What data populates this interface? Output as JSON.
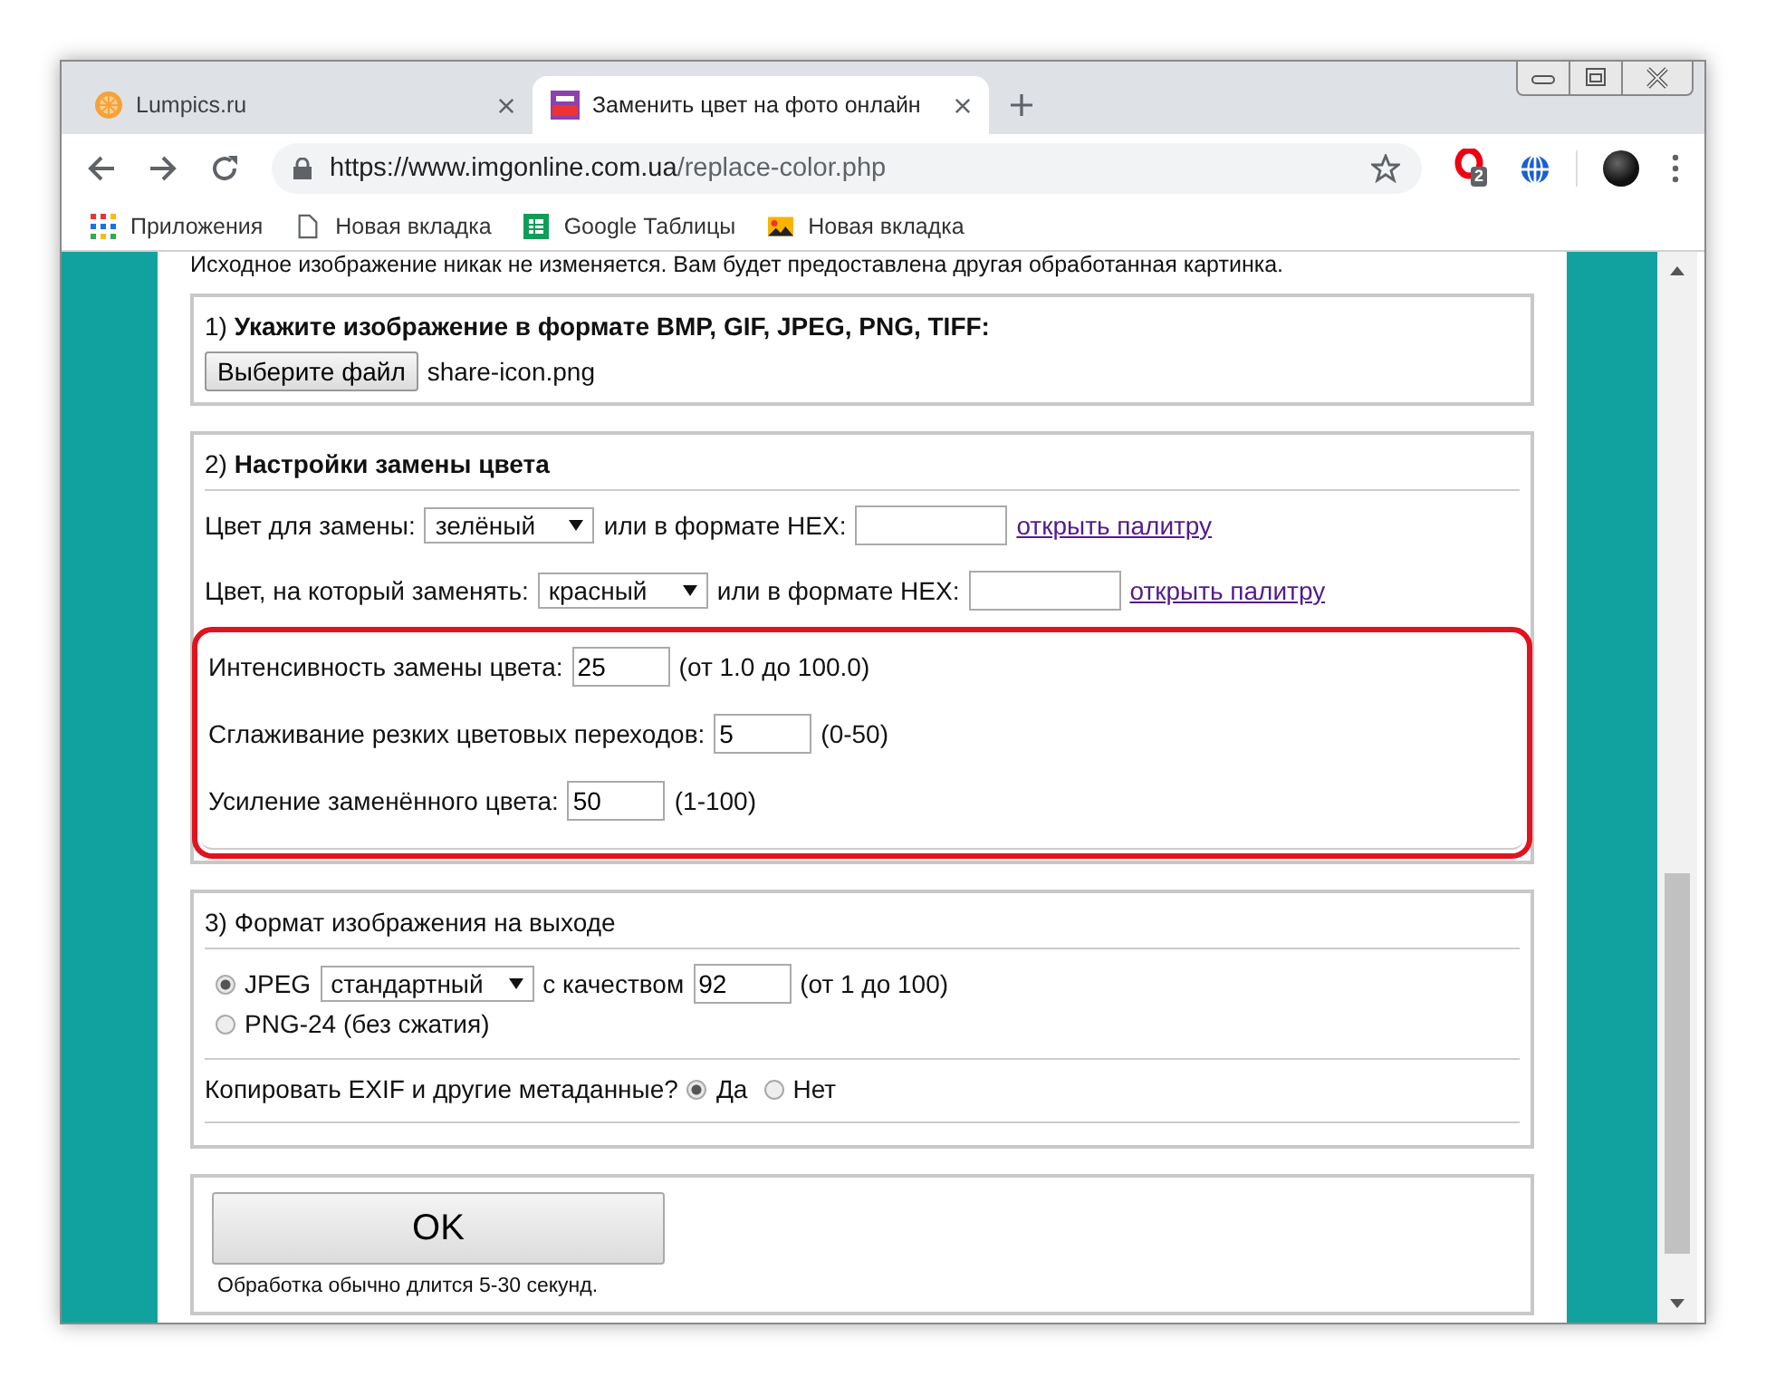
{
  "tabs": [
    {
      "title": "Lumpics.ru",
      "kind": "orange",
      "selected": false
    },
    {
      "title": "Заменить цвет на фото онлайн",
      "kind": "jpg",
      "selected": true
    }
  ],
  "address": {
    "host": "https://www.imgonline.com.ua",
    "path": "/replace-color.php"
  },
  "extension_badge": "2",
  "bookmarks": [
    {
      "label": "Приложения",
      "kind": "apps"
    },
    {
      "label": "Новая вкладка",
      "kind": "page"
    },
    {
      "label": "Google Таблицы",
      "kind": "sheets"
    },
    {
      "label": "Новая вкладка",
      "kind": "image"
    }
  ],
  "intro": "Исходное изображение никак не изменяется. Вам будет предоставлена другая обработанная картинка.",
  "section1": {
    "number": "1)",
    "title": "Укажите изображение в формате BMP, GIF, JPEG, PNG, TIFF:",
    "file_button": "Выберите файл",
    "file_name": "share-icon.png"
  },
  "section2": {
    "number": "2)",
    "title": "Настройки замены цвета",
    "color_rows": [
      {
        "label": "Цвет для замены:",
        "select": "зелёный",
        "hex_label": "или в формате HEX:",
        "link": "открыть палитру"
      },
      {
        "label": "Цвет, на который заменять:",
        "select": "красный",
        "hex_label": "или в формате HEX:",
        "link": "открыть палитру"
      }
    ],
    "highlighted": true,
    "settings": [
      {
        "label": "Интенсивность замены цвета:",
        "value": "25",
        "range": "(от 1.0 до 100.0)"
      },
      {
        "label": "Сглаживание резких цветовых переходов:",
        "value": "5",
        "range": "(0-50)"
      },
      {
        "label": "Усиление заменённого цвета:",
        "value": "50",
        "range": "(1-100)"
      }
    ]
  },
  "section3": {
    "number": "3)",
    "title": "Формат изображения на выходе",
    "formats": [
      {
        "label": "JPEG",
        "selected": true,
        "select": "стандартный",
        "quality_label": "с качеством",
        "quality": "92",
        "range": "(от 1 до 100)"
      },
      {
        "label": "PNG-24 (без сжатия)",
        "selected": false
      }
    ],
    "exif": {
      "label": "Копировать EXIF и другие метаданные?",
      "options": [
        {
          "label": "Да",
          "selected": true
        },
        {
          "label": "Нет",
          "selected": false
        }
      ]
    }
  },
  "submit": {
    "label": "OK",
    "note": "Обработка обычно длится 5-30 секунд."
  }
}
